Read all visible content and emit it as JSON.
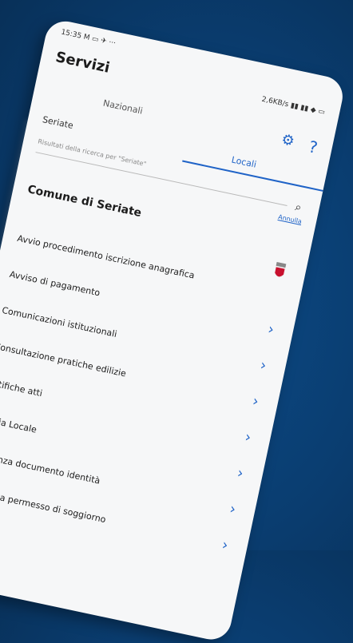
{
  "status_bar": {
    "time": "15:35 M ▭ ✈ ···",
    "network": "2,6KB/s ▮▮ ▮▮ ◆ ▭"
  },
  "header": {
    "title": "Servizi",
    "tab_nazionali": "Nazionali",
    "tab_locali": "Locali"
  },
  "search": {
    "value": "Seriate",
    "results_label": "Risultati della ricerca per \"Seriate\"",
    "cancel_label": "Annulla"
  },
  "comune": {
    "name": "Comune di Seriate"
  },
  "services": [
    "Avvio procedimento iscrizione anagrafica",
    "Avviso di pagamento",
    "Comunicazioni istituzionali",
    "Consultazione pratiche edilizie",
    "Notifiche atti",
    "Polizia Locale",
    "Scadenza documento identità",
    "Scadenza permesso di soggiorno"
  ],
  "colors": {
    "accent": "#1f63c7",
    "background": "#0a3d70"
  }
}
